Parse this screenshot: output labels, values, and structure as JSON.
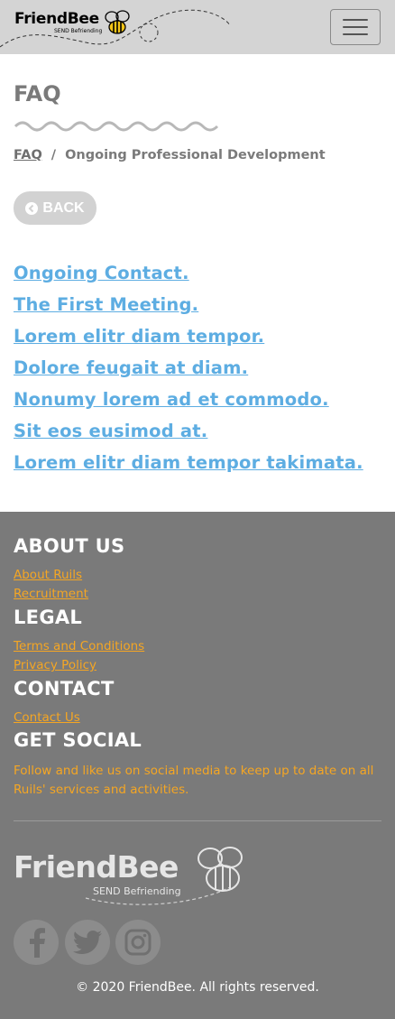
{
  "header": {
    "logo_text": "FriendBee",
    "logo_subtitle": "SEND Befriending",
    "menu_icon": "hamburger-icon"
  },
  "page": {
    "title": "FAQ",
    "breadcrumb": {
      "root": "FAQ",
      "separator": "/",
      "current": "Ongoing Professional Development"
    },
    "back_label": "BACK",
    "back_icon": "arrow-left-icon"
  },
  "faq_links": [
    "Ongoing Contact.",
    "The First Meeting.",
    "Lorem elitr diam tempor.",
    "Dolore feugait at diam.",
    "Nonumy lorem ad et commodo.",
    "Sit eos eusimod at.",
    "Lorem elitr diam tempor takimata."
  ],
  "footer": {
    "about": {
      "heading": "ABOUT US",
      "links": [
        "About Ruils",
        "Recruitment"
      ]
    },
    "legal": {
      "heading": "LEGAL",
      "links": [
        "Terms and Conditions",
        "Privacy Policy"
      ]
    },
    "contact": {
      "heading": "CONTACT",
      "links": [
        "Contact Us"
      ]
    },
    "social": {
      "heading": "GET SOCIAL",
      "text": "Follow and like us on social media to keep up to date on all Ruils' services and activities.",
      "icons": [
        "facebook-icon",
        "twitter-icon",
        "instagram-icon"
      ]
    },
    "logo_text": "FriendBee",
    "logo_subtitle": "SEND Befriending",
    "copyright": "© 2020 FriendBee. All rights reserved."
  },
  "colors": {
    "header_bg": "#d4d4d4",
    "link_blue": "#5dade2",
    "footer_bg": "#7a7a7a",
    "footer_link": "#f5a623"
  }
}
